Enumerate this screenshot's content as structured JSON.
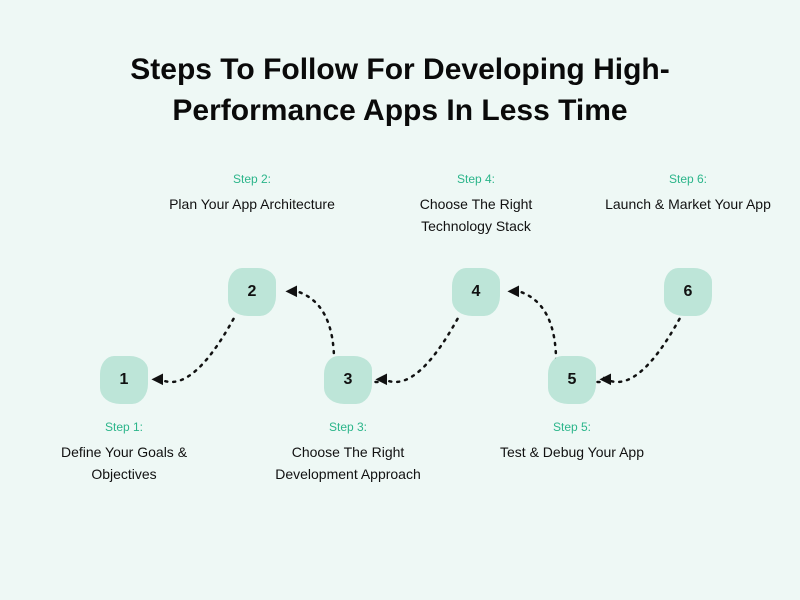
{
  "title": "Steps To Follow For Developing High-Performance Apps In Less Time",
  "steps": [
    {
      "num": "1",
      "label": "Step 1:",
      "text": "Define Your Goals & Objectives"
    },
    {
      "num": "2",
      "label": "Step 2:",
      "text": "Plan Your App Architecture"
    },
    {
      "num": "3",
      "label": "Step 3:",
      "text": "Choose The Right Development Approach"
    },
    {
      "num": "4",
      "label": "Step 4:",
      "text": "Choose The Right Technology Stack"
    },
    {
      "num": "5",
      "label": "Step 5:",
      "text": "Test & Debug Your App"
    },
    {
      "num": "6",
      "label": "Step 6:",
      "text": "Launch & Market Your App"
    }
  ],
  "colors": {
    "accent": "#2bb58a",
    "node": "#bde5d8",
    "bg": "#eef8f5"
  }
}
